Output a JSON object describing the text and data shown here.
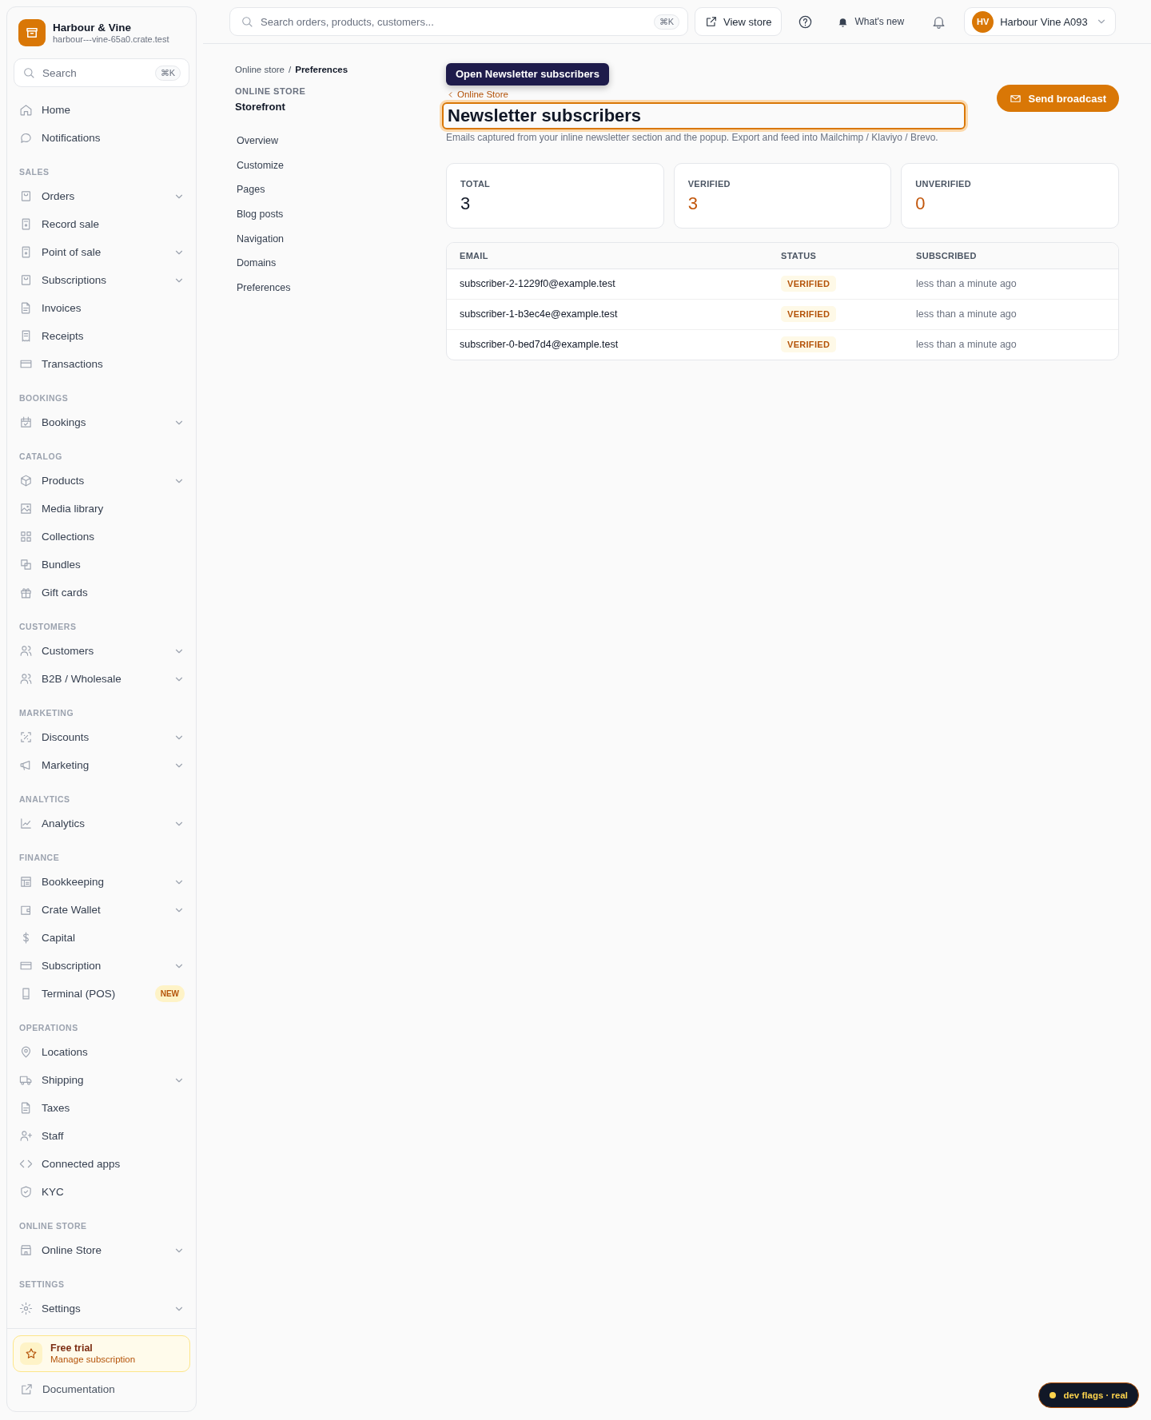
{
  "brand": {
    "name": "Harbour & Vine",
    "domain": "harbour---vine-65a0.crate.test"
  },
  "sidebar_search": {
    "placeholder": "Search",
    "shortcut": "⌘K"
  },
  "sidebar": {
    "sections": [
      {
        "items": [
          {
            "label": "Home",
            "expandable": false
          },
          {
            "label": "Notifications",
            "expandable": false
          }
        ]
      },
      {
        "title": "SALES",
        "items": [
          {
            "label": "Orders",
            "expandable": true
          },
          {
            "label": "Record sale",
            "expandable": false
          },
          {
            "label": "Point of sale",
            "expandable": true
          },
          {
            "label": "Subscriptions",
            "expandable": true
          },
          {
            "label": "Invoices",
            "expandable": false
          },
          {
            "label": "Receipts",
            "expandable": false
          },
          {
            "label": "Transactions",
            "expandable": false
          }
        ]
      },
      {
        "title": "BOOKINGS",
        "items": [
          {
            "label": "Bookings",
            "expandable": true
          }
        ]
      },
      {
        "title": "CATALOG",
        "items": [
          {
            "label": "Products",
            "expandable": true
          },
          {
            "label": "Media library",
            "expandable": false
          },
          {
            "label": "Collections",
            "expandable": false
          },
          {
            "label": "Bundles",
            "expandable": false
          },
          {
            "label": "Gift cards",
            "expandable": false
          }
        ]
      },
      {
        "title": "CUSTOMERS",
        "items": [
          {
            "label": "Customers",
            "expandable": true
          },
          {
            "label": "B2B / Wholesale",
            "expandable": true
          }
        ]
      },
      {
        "title": "MARKETING",
        "items": [
          {
            "label": "Discounts",
            "expandable": true
          },
          {
            "label": "Marketing",
            "expandable": true
          }
        ]
      },
      {
        "title": "ANALYTICS",
        "items": [
          {
            "label": "Analytics",
            "expandable": true
          }
        ]
      },
      {
        "title": "FINANCE",
        "items": [
          {
            "label": "Bookkeeping",
            "expandable": true
          },
          {
            "label": "Crate Wallet",
            "expandable": true
          },
          {
            "label": "Capital",
            "expandable": false
          },
          {
            "label": "Subscription",
            "expandable": true
          },
          {
            "label": "Terminal (POS)",
            "expandable": false,
            "badge": "NEW"
          }
        ]
      },
      {
        "title": "OPERATIONS",
        "items": [
          {
            "label": "Locations",
            "expandable": false
          },
          {
            "label": "Shipping",
            "expandable": true
          },
          {
            "label": "Taxes",
            "expandable": false
          },
          {
            "label": "Staff",
            "expandable": false
          },
          {
            "label": "Connected apps",
            "expandable": false
          },
          {
            "label": "KYC",
            "expandable": false
          }
        ]
      },
      {
        "title": "ONLINE STORE",
        "items": [
          {
            "label": "Online Store",
            "expandable": true
          }
        ]
      },
      {
        "title": "SETTINGS",
        "items": [
          {
            "label": "Settings",
            "expandable": true
          }
        ]
      }
    ]
  },
  "sidebar_footer": {
    "trial": {
      "title": "Free trial",
      "subtitle": "Manage subscription"
    },
    "documentation": "Documentation"
  },
  "top_bar": {
    "search": {
      "placeholder": "Search orders, products, customers...",
      "shortcut": "⌘K"
    },
    "view_store": "View store",
    "whats_new": "What's new",
    "account": {
      "initials": "HV",
      "name": "Harbour Vine A093"
    }
  },
  "breadcrumb": {
    "items": [
      "Online store",
      "Preferences"
    ],
    "separator": "/"
  },
  "subnav": {
    "eyebrow": "ONLINE STORE",
    "title": "Storefront",
    "items": [
      "Overview",
      "Customize",
      "Pages",
      "Blog posts",
      "Navigation",
      "Domains",
      "Preferences"
    ]
  },
  "page": {
    "tooltip": "Open Newsletter subscribers",
    "back_link": "Online Store",
    "title": "Newsletter subscribers",
    "title_focused": true,
    "description": "Emails captured from your inline newsletter section and the popup. Export and feed into Mailchimp / Klaviyo / Brevo.",
    "action": "Send broadcast"
  },
  "stats": [
    {
      "label": "TOTAL",
      "value": "3",
      "accent": false
    },
    {
      "label": "VERIFIED",
      "value": "3",
      "accent": true
    },
    {
      "label": "UNVERIFIED",
      "value": "0",
      "accent": true
    }
  ],
  "table": {
    "columns": [
      "EMAIL",
      "STATUS",
      "SUBSCRIBED"
    ],
    "rows": [
      {
        "email": "subscriber-2-1229f0@example.test",
        "status": "VERIFIED",
        "subscribed": "less than a minute ago"
      },
      {
        "email": "subscriber-1-b3ec4e@example.test",
        "status": "VERIFIED",
        "subscribed": "less than a minute ago"
      },
      {
        "email": "subscriber-0-bed7d4@example.test",
        "status": "VERIFIED",
        "subscribed": "less than a minute ago"
      }
    ]
  },
  "dev_flag": "dev flags · real"
}
